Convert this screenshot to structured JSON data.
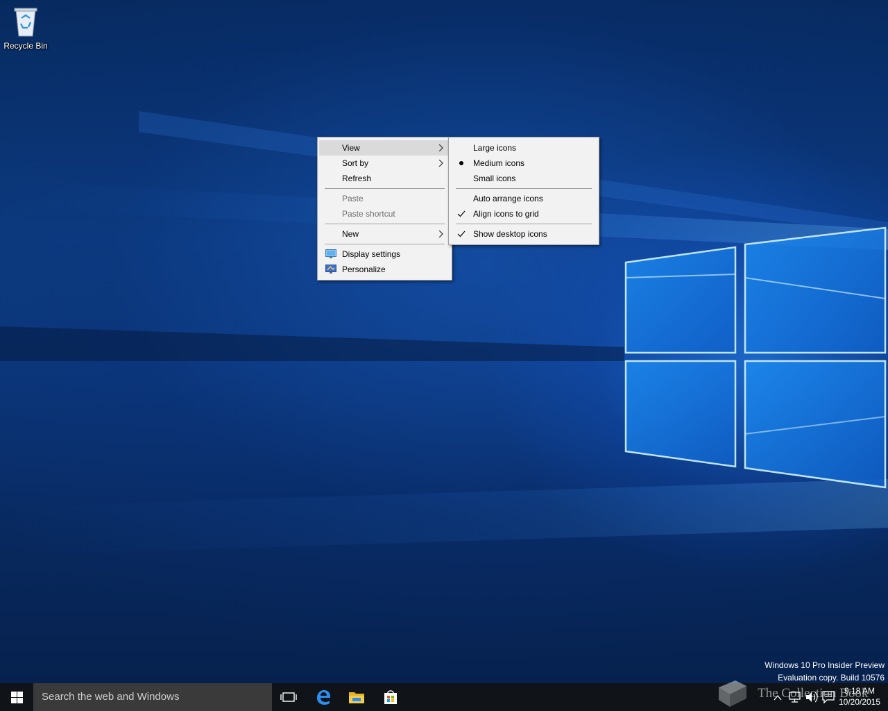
{
  "desktop": {
    "icons": [
      {
        "label": "Recycle Bin",
        "icon": "recycle-bin-icon"
      }
    ]
  },
  "context_menu": {
    "items": [
      {
        "label": "View",
        "has_submenu": true,
        "highlighted": true,
        "enabled": true
      },
      {
        "label": "Sort by",
        "has_submenu": true,
        "enabled": true
      },
      {
        "label": "Refresh",
        "enabled": true
      },
      {
        "label": "Paste",
        "enabled": false
      },
      {
        "label": "Paste shortcut",
        "enabled": false
      },
      {
        "label": "New",
        "has_submenu": true,
        "enabled": true
      },
      {
        "label": "Display settings",
        "icon": "display-settings-icon",
        "enabled": true
      },
      {
        "label": "Personalize",
        "icon": "personalize-icon",
        "enabled": true
      }
    ]
  },
  "view_submenu": {
    "items": [
      {
        "label": "Large icons",
        "state": "none"
      },
      {
        "label": "Medium icons",
        "state": "radio-selected"
      },
      {
        "label": "Small icons",
        "state": "none"
      },
      {
        "label": "Auto arrange icons",
        "state": "none"
      },
      {
        "label": "Align icons to grid",
        "state": "checked"
      },
      {
        "label": "Show desktop icons",
        "state": "checked"
      }
    ]
  },
  "watermark": {
    "line1": "Windows 10 Pro Insider Preview",
    "line2": "Evaluation copy. Build 10576"
  },
  "brand_watermark": {
    "text": "The Collection Book"
  },
  "taskbar": {
    "search_placeholder": "Search the web and Windows",
    "pinned": [
      "task-view-icon",
      "edge-icon",
      "file-explorer-icon",
      "store-icon"
    ],
    "tray_icons": [
      "chevron-up-icon",
      "network-icon",
      "volume-icon",
      "action-center-icon"
    ],
    "clock_time": "9:18 AM",
    "clock_date": "10/20/2015"
  },
  "colors": {
    "taskbar": "#101418",
    "menu_bg": "#f2f2f2",
    "menu_highlight": "#dadada",
    "accent": "#1e90ff"
  }
}
